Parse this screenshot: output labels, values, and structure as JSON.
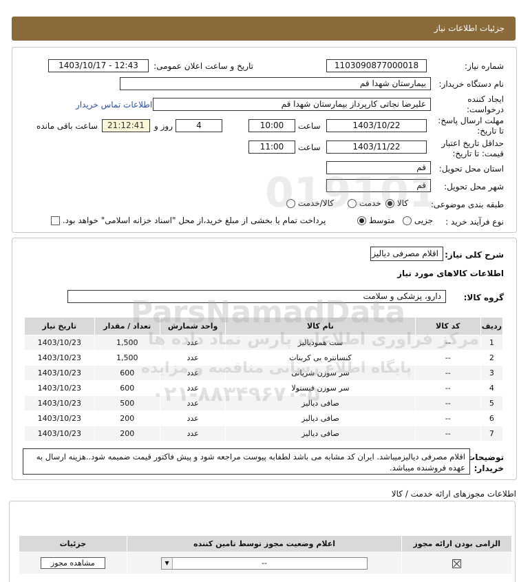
{
  "header": {
    "title": "جزئیات اطلاعات نیاز"
  },
  "form": {
    "need_number_label": "شماره نیاز:",
    "need_number": "1103090877000018",
    "announce_label": "تاریخ و ساعت اعلان عمومی:",
    "announce_value": "1403/10/17 - 12:43",
    "buyer_org_label": "نام دستگاه خریدار:",
    "buyer_org": "بیمارستان شهدا قم",
    "creator_label_1": "ایجاد کننده",
    "creator_label_2": "درخواست:",
    "creator": "علیرضا نجاتی کارپرداز بیمارستان شهدا قم",
    "contact_link": "اطلاعات تماس خریدار",
    "deadline_label_1": "مهلت ارسال پاسخ:",
    "deadline_label_2": "تا تاریخ:",
    "deadline_date": "1403/10/22",
    "time_label": "ساعت",
    "deadline_time": "10:00",
    "days_value": "4",
    "days_label": "روز و",
    "remaining_time": "21:12:41",
    "remaining_label": "ساعت باقی مانده",
    "validity_label_1": "حداقل تاریخ اعتبار",
    "validity_label_2": "قیمت: تا تاریخ:",
    "validity_date": "1403/11/22",
    "validity_time_label": "ساعت",
    "validity_time": "11:00",
    "province_label": "استان محل تحویل:",
    "province": "قم",
    "city_label": "شهر محل تحویل:",
    "city": "قم",
    "category_label": "طبقه بندی موضوعی:",
    "category_options": [
      "کالا",
      "خدمت",
      "کالا/خدمت"
    ],
    "process_label": "نوع فرآیند خرید :",
    "process_options": [
      "جزیی",
      "متوسط"
    ],
    "payment_text": "پرداخت تمام یا بخشی از مبلغ خرید،از محل \"اسناد خزانه اسلامی\" خواهد بود."
  },
  "summary": {
    "label": "شرح کلی نیاز:",
    "value": "اقلام مصرفی دیالیز",
    "items_title": "اطلاعات کالاهای مورد نیاز",
    "group_label": "گروه کالا:",
    "group_value": "دارو، پزشکی و سلامت"
  },
  "items_table": {
    "headers": [
      "ردیف",
      "کد کالا",
      "نام کالا",
      "واحد شمارش",
      "تعداد / مقدار",
      "تاریخ نیاز"
    ],
    "rows": [
      {
        "row": "1",
        "code": "--",
        "name": "ست همودیالیز",
        "unit": "عدد",
        "qty": "1,500",
        "date": "1403/10/23"
      },
      {
        "row": "2",
        "code": "--",
        "name": "کنسانتره بی کربنات",
        "unit": "عدد",
        "qty": "1,500",
        "date": "1403/10/23"
      },
      {
        "row": "3",
        "code": "--",
        "name": "سر سوزن شریانی",
        "unit": "عدد",
        "qty": "600",
        "date": "1403/10/23"
      },
      {
        "row": "4",
        "code": "--",
        "name": "سر سوزن فیستولا",
        "unit": "عدد",
        "qty": "600",
        "date": "1403/10/23"
      },
      {
        "row": "5",
        "code": "--",
        "name": "صافی دیالیز",
        "unit": "عدد",
        "qty": "500",
        "date": "1403/10/23"
      },
      {
        "row": "6",
        "code": "--",
        "name": "صافی دیالیز",
        "unit": "عدد",
        "qty": "200",
        "date": "1403/10/23"
      },
      {
        "row": "7",
        "code": "--",
        "name": "صافی دیالیز",
        "unit": "عدد",
        "qty": "200",
        "date": "1403/10/23"
      }
    ]
  },
  "notes": {
    "label_1": "توضیحات",
    "label_2": "خریدار:",
    "text": "اقلام مصرفی دیالیزمیباشد. ایران کد مشابه می باشد لطفابه پیوست مراجعه شود و پیش فاکتور قیمت ضمیمه شود..هزینه ارسال به عهده فروشنده میباشد."
  },
  "permits": {
    "title": "اطلاعات مجوزهای ارائه خدمت / کالا",
    "headers": [
      "الزامی بودن ارائه مجوز",
      "اعلام وضعیت مجوز توسط تامین کننده",
      "جزئیات"
    ],
    "select_value": "--",
    "view_button": "مشاهده مجوز"
  },
  "watermark": {
    "line1": "ParsNamadData",
    "line2": "مرکز فراوری اطلاعات پارس نماد داده ها",
    "line3": "پایگاه اطلاع رسانی مناقصه و مزایده",
    "phone": "۰۲۱-۸۸۳۴۹۶۷۰-۵",
    "digits": "019101"
  }
}
